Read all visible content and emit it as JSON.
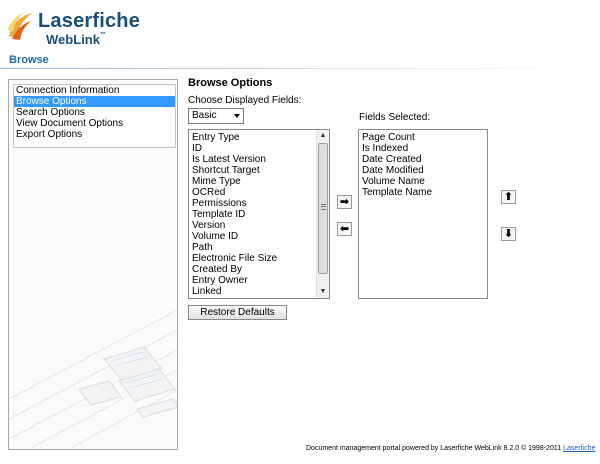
{
  "logo": {
    "brand": "Laserfiche",
    "product": "WebLink",
    "tm": "™"
  },
  "page": {
    "heading": "Browse"
  },
  "sidebar": {
    "items": [
      {
        "label": "Connection Information",
        "selected": false
      },
      {
        "label": "Browse Options",
        "selected": true
      },
      {
        "label": "Search Options",
        "selected": false
      },
      {
        "label": "View Document Options",
        "selected": false
      },
      {
        "label": "Export Options",
        "selected": false
      }
    ]
  },
  "browse": {
    "title": "Browse Options",
    "fields_caption": "Choose Displayed Fields:",
    "view_select": {
      "value": "Basic"
    },
    "available_fields": [
      "Entry Type",
      "ID",
      "Is Latest Version",
      "Shortcut Target",
      "Mime Type",
      "OCRed",
      "Permissions",
      "Template ID",
      "Version",
      "Volume ID",
      "Path",
      "Electronic File Size",
      "Created By",
      "Entry Owner",
      "Linked"
    ],
    "selected_caption": "Fields Selected:",
    "selected_fields": [
      "Page Count",
      "Is Indexed",
      "Date Created",
      "Date Modified",
      "Volume Name",
      "Template Name"
    ],
    "buttons": {
      "add": "➡",
      "remove": "⬅",
      "up": "⬆",
      "down": "⬇",
      "restore": "Restore Defaults"
    }
  },
  "footer": {
    "text": "Document management portal powered by Laserfiche WebLink 8.2.0 © 1998-2011",
    "link": "Laserfiche"
  },
  "colors": {
    "brand": "#1a4f7a",
    "heading": "#1a6aa3",
    "selection": "#3399ff"
  }
}
